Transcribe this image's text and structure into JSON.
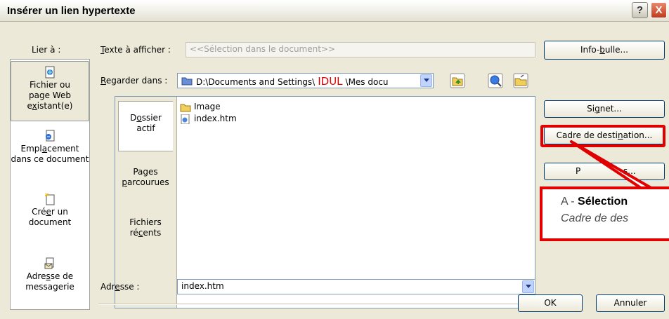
{
  "title_bar": {
    "title": "Insérer un lien hypertexte",
    "help": "?",
    "close": "X"
  },
  "link_to": {
    "label": "Lier à :",
    "items": [
      {
        "pre": "",
        "u": "",
        "post": "Fichier ou page Web ",
        "u2": "x",
        "pre2": "e",
        "post2": "istant(e)",
        "icon": "web-page-icon"
      },
      {
        "pre": "Empl",
        "u": "a",
        "post": "cement dans ce document",
        "icon": "document-place-icon"
      },
      {
        "pre": "Cré",
        "u": "e",
        "post": "r un document",
        "icon": "new-document-icon"
      },
      {
        "pre": "Adre",
        "u": "s",
        "post": "se de messagerie",
        "icon": "email-address-icon"
      }
    ]
  },
  "text_to_display": {
    "label_u": "T",
    "label_rest": "exte à afficher :",
    "value": "<<Sélection dans le document>>"
  },
  "screentip_button": {
    "pre": "Info-",
    "u": "b",
    "post": "ulle..."
  },
  "look_in": {
    "label_u": "R",
    "label_rest": "egarder dans :",
    "path_prefix": "D:\\Documents and Settings\\",
    "path_highlight": "IDUL",
    "path_suffix": "\\Mes docu"
  },
  "tabs": [
    {
      "pre": "D",
      "u": "o",
      "post": "ssier actif",
      "line1": "Dossier",
      "line2": "actif"
    },
    {
      "line1": "Pages",
      "line2_pre": "",
      "line2_u": "p",
      "line2_post": "arcourues"
    },
    {
      "line1": "Fichiers",
      "line2_pre": "ré",
      "line2_u": "c",
      "line2_post": "ents"
    }
  ],
  "files": [
    {
      "name": "Image",
      "icon": "folder-icon"
    },
    {
      "name": "index.htm",
      "icon": "html-file-icon"
    }
  ],
  "bookmark_button": {
    "pre": "Si",
    "u": "g",
    "post": "net..."
  },
  "target_frame_button": {
    "pre": "Cadre de desti",
    "u": "n",
    "post": "ation..."
  },
  "parameters_button": {
    "visible_left": "P",
    "visible_right": "s..."
  },
  "address": {
    "label_pre": "Adr",
    "label_u": "e",
    "label_post": "sse :",
    "value": "index.htm"
  },
  "ok_button": "OK",
  "cancel_button": "Annuler",
  "callout": {
    "prefix": "A - ",
    "bold": "Sélection",
    "line2": "Cadre de des"
  },
  "colors": {
    "annotation_red": "#e00000",
    "idul_red": "#e00000",
    "dialog_bg": "#ece9d8"
  }
}
